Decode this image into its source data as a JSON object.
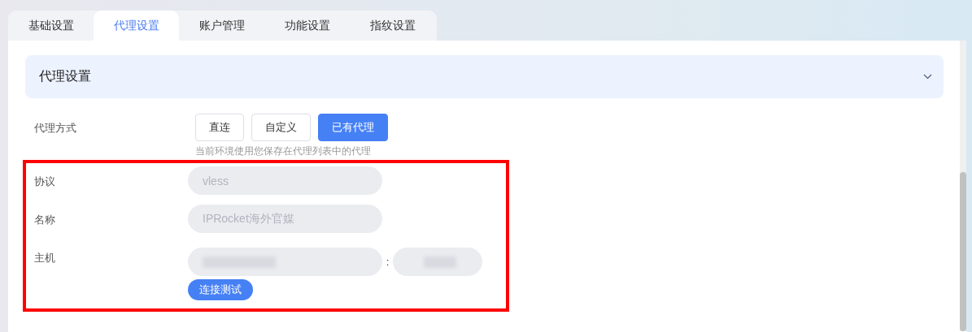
{
  "tabs": [
    {
      "label": "基础设置",
      "selected": false
    },
    {
      "label": "代理设置",
      "selected": true
    },
    {
      "label": "账户管理",
      "selected": false
    },
    {
      "label": "功能设置",
      "selected": false
    },
    {
      "label": "指纹设置",
      "selected": false
    }
  ],
  "section": {
    "title": "代理设置",
    "expanded": true
  },
  "proxy_mode": {
    "label": "代理方式",
    "options": [
      {
        "label": "直连",
        "selected": false
      },
      {
        "label": "自定义",
        "selected": false
      },
      {
        "label": "已有代理",
        "selected": true
      }
    ],
    "hint": "当前环境使用您保存在代理列表中的代理"
  },
  "fields": [
    {
      "label": "协议",
      "value": "vless",
      "disabled": true
    },
    {
      "label": "名称",
      "value": "IPRocket海外官媒",
      "disabled": true
    }
  ],
  "host": {
    "label": "主机",
    "separator": ":"
  },
  "test_button": "连接测试"
}
